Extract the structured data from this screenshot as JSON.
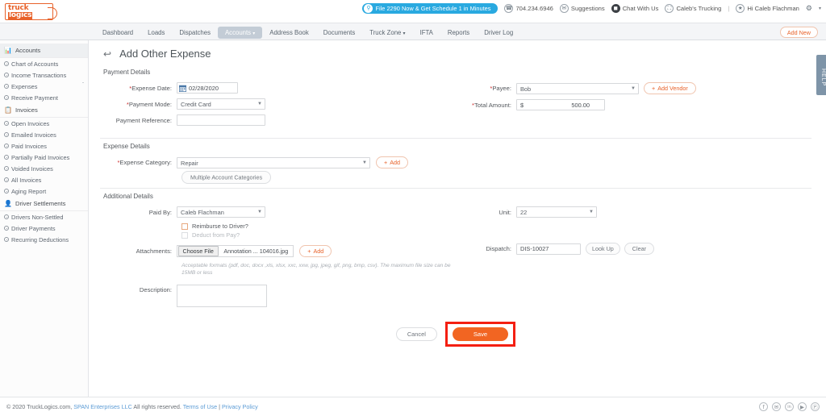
{
  "topbar": {
    "logo_line1": "truck",
    "logo_line2": "logics",
    "promo_pill": "File 2290 Now & Get Schedule 1 in Minutes",
    "phone": "704.234.6946",
    "suggestions": "Suggestions",
    "chat": "Chat With Us",
    "company": "Caleb's Trucking",
    "divider": "|",
    "greeting": "Hi Caleb Flachman",
    "gear_caret": "▾"
  },
  "nav": {
    "items": [
      {
        "label": "Dashboard",
        "active": false,
        "caret": ""
      },
      {
        "label": "Loads",
        "active": false,
        "caret": ""
      },
      {
        "label": "Dispatches",
        "active": false,
        "caret": ""
      },
      {
        "label": "Accounts",
        "active": true,
        "caret": "▾"
      },
      {
        "label": "Address Book",
        "active": false,
        "caret": ""
      },
      {
        "label": "Documents",
        "active": false,
        "caret": ""
      },
      {
        "label": "Truck Zone",
        "active": false,
        "caret": "▾"
      },
      {
        "label": "IFTA",
        "active": false,
        "caret": ""
      },
      {
        "label": "Reports",
        "active": false,
        "caret": ""
      },
      {
        "label": "Driver Log",
        "active": false,
        "caret": ""
      }
    ],
    "add_new": "Add New"
  },
  "sidebar": {
    "groups": [
      {
        "label": "Accounts",
        "icon": "bar-chart-icon",
        "selected": true,
        "items": [
          {
            "label": "Chart of Accounts",
            "chevron": ""
          },
          {
            "label": "Income Transactions",
            "chevron": ""
          },
          {
            "label": "Expenses",
            "chevron": "ˇ"
          },
          {
            "label": "Receive Payment",
            "chevron": ""
          }
        ]
      },
      {
        "label": "Invoices",
        "icon": "invoice-icon",
        "selected": false,
        "items": [
          {
            "label": "Open Invoices",
            "chevron": ""
          },
          {
            "label": "Emailed Invoices",
            "chevron": ""
          },
          {
            "label": "Paid Invoices",
            "chevron": ""
          },
          {
            "label": "Partially Paid Invoices",
            "chevron": ""
          },
          {
            "label": "Voided Invoices",
            "chevron": ""
          },
          {
            "label": "All Invoices",
            "chevron": ""
          },
          {
            "label": "Aging Report",
            "chevron": ""
          }
        ]
      },
      {
        "label": "Driver Settlements",
        "icon": "driver-icon",
        "selected": false,
        "items": [
          {
            "label": "Drivers Non-Settled",
            "chevron": ""
          },
          {
            "label": "Driver Payments",
            "chevron": ""
          },
          {
            "label": "Recurring Deductions",
            "chevron": ""
          }
        ]
      }
    ]
  },
  "page": {
    "title": "Add Other Expense",
    "back_icon": "↩"
  },
  "payment_details": {
    "section_title": "Payment Details",
    "expense_date_label": "Expense Date:",
    "expense_date_value": "02/28/2020",
    "payment_mode_label": "Payment Mode:",
    "payment_mode_value": "Credit Card",
    "payment_reference_label": "Payment Reference:",
    "payment_reference_value": "",
    "payee_label": "Payee:",
    "payee_value": "Bob",
    "add_vendor_label": "Add Vendor",
    "total_amount_label": "Total Amount:",
    "total_amount_currency": "$",
    "total_amount_value": "500.00"
  },
  "expense_details": {
    "section_title": "Expense Details",
    "expense_category_label": "Expense Category:",
    "expense_category_value": "Repair",
    "add_label": "Add",
    "multiple_account_categories": "Multiple Account Categories"
  },
  "additional_details": {
    "section_title": "Additional Details",
    "paid_by_label": "Paid By:",
    "paid_by_value": "Caleb Flachman",
    "reimburse_label": "Reimburse to Driver?",
    "reimburse_checked": false,
    "deduct_label": "Deduct from Pay?",
    "deduct_checked": false,
    "attachments_label": "Attachments:",
    "choose_file_label": "Choose File",
    "file_name": "Annotation ... 104016.jpg",
    "attach_add_label": "Add",
    "hint": "Acceptable formats (pdf, doc, docx ,xls, xlsx, xxc, xxw, jpg, jpeg, gif, png, bmp, csv). The maximum file size can be 15MB or less",
    "description_label": "Description:",
    "description_value": "",
    "unit_label": "Unit:",
    "unit_value": "22",
    "dispatch_label": "Dispatch:",
    "dispatch_value": "DIS-10027",
    "look_up_label": "Look Up",
    "clear_label": "Clear"
  },
  "actions": {
    "cancel_label": "Cancel",
    "save_label": "Save",
    "highlight_color": "#f41f12"
  },
  "help_tab": {
    "label": "HELP"
  },
  "footer": {
    "copyright_prefix": "© 2020 TruckLogics.com, ",
    "company_link": "SPAN Enterprises LLC",
    "rights": " All rights reserved. ",
    "terms": "Terms of Use",
    "sep": " | ",
    "privacy": "Privacy Policy",
    "socials": [
      {
        "name": "facebook-icon",
        "glyph": "f"
      },
      {
        "name": "twitter-icon",
        "glyph": "✉"
      },
      {
        "name": "linkedin-icon",
        "glyph": "in"
      },
      {
        "name": "youtube-icon",
        "glyph": "▶"
      },
      {
        "name": "pinterest-icon",
        "glyph": "Ⓟ"
      }
    ]
  },
  "theme": {
    "brand_orange": "#e8622a",
    "save_orange": "#f26522",
    "promo_blue": "#29a9e0",
    "nav_active": "#c3ccd6"
  }
}
